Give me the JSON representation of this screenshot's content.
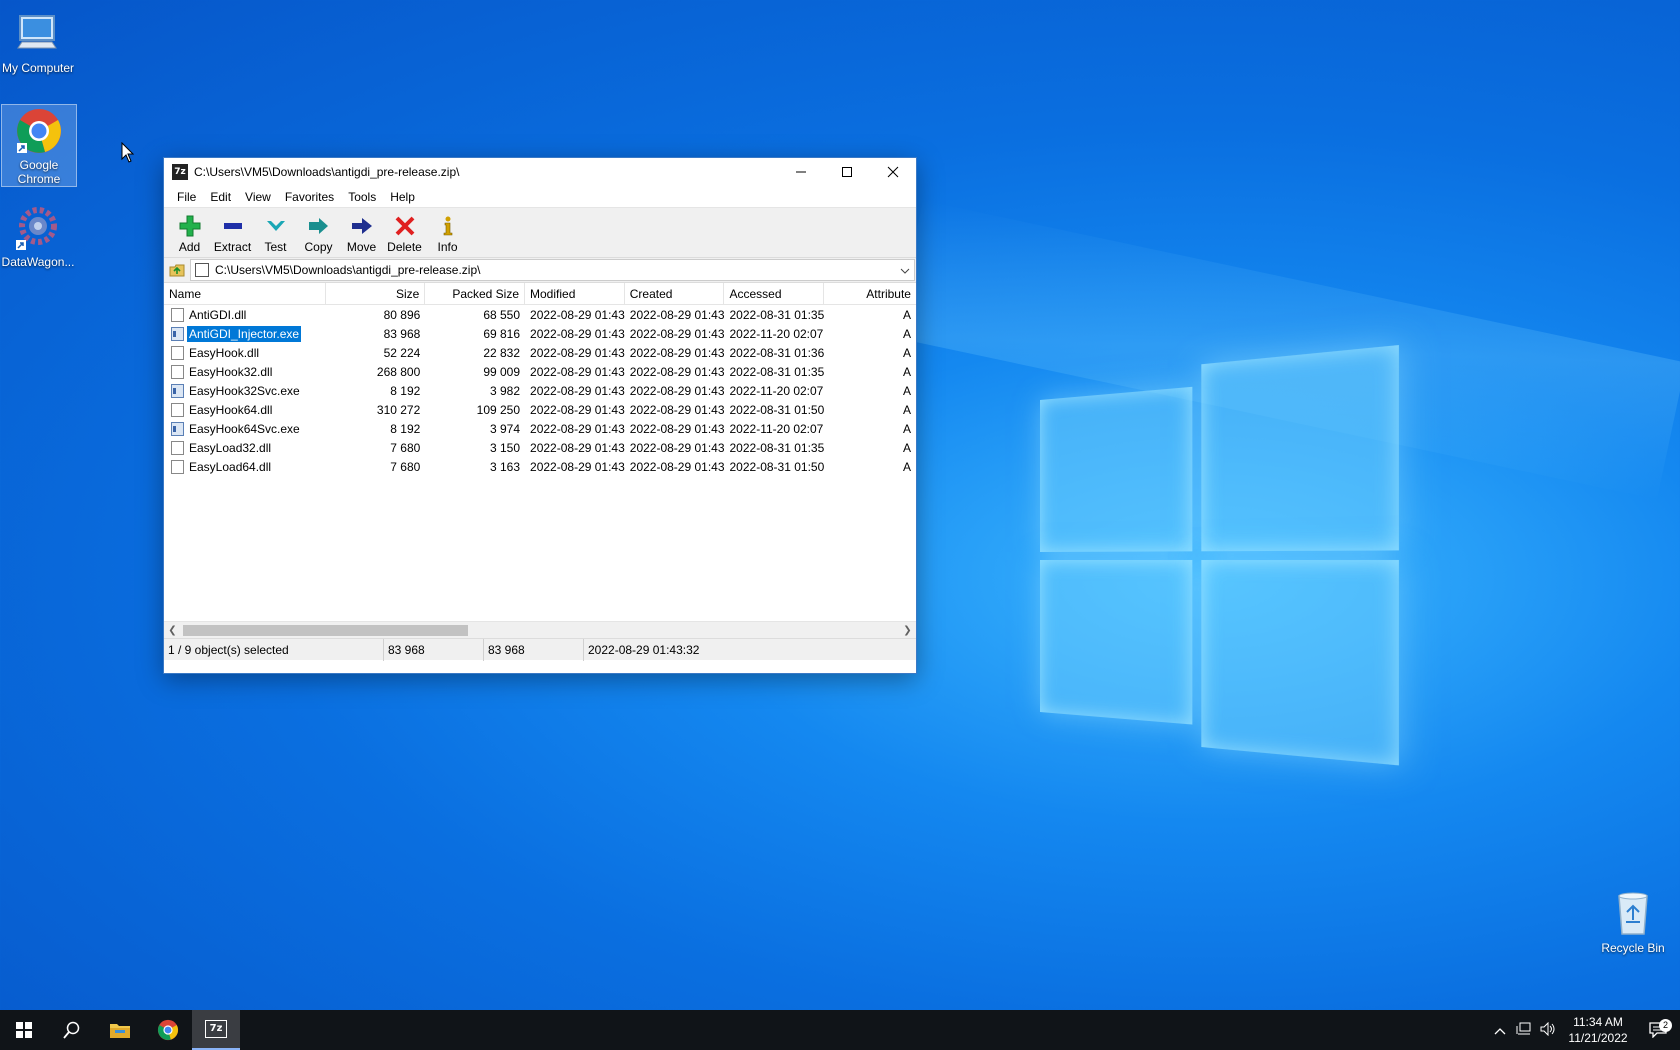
{
  "desktop": {
    "icons": [
      {
        "label": "My Computer"
      },
      {
        "label": "Google Chrome"
      },
      {
        "label": "DataWagon..."
      },
      {
        "label": "Recycle Bin"
      }
    ]
  },
  "window": {
    "title": "C:\\Users\\VM5\\Downloads\\antigdi_pre-release.zip\\",
    "app_icon_text": "7z",
    "menu": [
      "File",
      "Edit",
      "View",
      "Favorites",
      "Tools",
      "Help"
    ],
    "toolbar": [
      {
        "label": "Add",
        "icon": "plus-icon",
        "color": "#22b14c"
      },
      {
        "label": "Extract",
        "icon": "minus-icon",
        "color": "#1f2fa8"
      },
      {
        "label": "Test",
        "icon": "check-chevron-icon",
        "color": "#1aa7b5"
      },
      {
        "label": "Copy",
        "icon": "double-arrow-icon",
        "color": "#1a8f8f"
      },
      {
        "label": "Move",
        "icon": "arrow-right-icon",
        "color": "#1f2f8f"
      },
      {
        "label": "Delete",
        "icon": "x-icon",
        "color": "#e02020"
      },
      {
        "label": "Info",
        "icon": "info-icon",
        "color": "#d0a000"
      }
    ],
    "address": "C:\\Users\\VM5\\Downloads\\antigdi_pre-release.zip\\",
    "columns": [
      "Name",
      "Size",
      "Packed Size",
      "Modified",
      "Created",
      "Accessed",
      "Attribute"
    ],
    "files": [
      {
        "name": "AntiGDI.dll",
        "type": "dll",
        "size": "80 896",
        "packed": "68 550",
        "modified": "2022-08-29 01:43",
        "created": "2022-08-29 01:43",
        "accessed": "2022-08-31 01:35",
        "attr": "A"
      },
      {
        "name": "AntiGDI_Injector.exe",
        "type": "exe",
        "size": "83 968",
        "packed": "69 816",
        "modified": "2022-08-29 01:43",
        "created": "2022-08-29 01:43",
        "accessed": "2022-11-20 02:07",
        "attr": "A",
        "selected": true
      },
      {
        "name": "EasyHook.dll",
        "type": "dll",
        "size": "52 224",
        "packed": "22 832",
        "modified": "2022-08-29 01:43",
        "created": "2022-08-29 01:43",
        "accessed": "2022-08-31 01:36",
        "attr": "A"
      },
      {
        "name": "EasyHook32.dll",
        "type": "dll",
        "size": "268 800",
        "packed": "99 009",
        "modified": "2022-08-29 01:43",
        "created": "2022-08-29 01:43",
        "accessed": "2022-08-31 01:35",
        "attr": "A"
      },
      {
        "name": "EasyHook32Svc.exe",
        "type": "exe",
        "size": "8 192",
        "packed": "3 982",
        "modified": "2022-08-29 01:43",
        "created": "2022-08-29 01:43",
        "accessed": "2022-11-20 02:07",
        "attr": "A"
      },
      {
        "name": "EasyHook64.dll",
        "type": "dll",
        "size": "310 272",
        "packed": "109 250",
        "modified": "2022-08-29 01:43",
        "created": "2022-08-29 01:43",
        "accessed": "2022-08-31 01:50",
        "attr": "A"
      },
      {
        "name": "EasyHook64Svc.exe",
        "type": "exe",
        "size": "8 192",
        "packed": "3 974",
        "modified": "2022-08-29 01:43",
        "created": "2022-08-29 01:43",
        "accessed": "2022-11-20 02:07",
        "attr": "A"
      },
      {
        "name": "EasyLoad32.dll",
        "type": "dll",
        "size": "7 680",
        "packed": "3 150",
        "modified": "2022-08-29 01:43",
        "created": "2022-08-29 01:43",
        "accessed": "2022-08-31 01:35",
        "attr": "A"
      },
      {
        "name": "EasyLoad64.dll",
        "type": "dll",
        "size": "7 680",
        "packed": "3 163",
        "modified": "2022-08-29 01:43",
        "created": "2022-08-29 01:43",
        "accessed": "2022-08-31 01:50",
        "attr": "A"
      }
    ],
    "status": {
      "selection": "1 / 9 object(s) selected",
      "size": "83 968",
      "packed": "83 968",
      "modified": "2022-08-29 01:43:32"
    }
  },
  "taskbar": {
    "time": "11:34 AM",
    "date": "11/21/2022",
    "notification_count": "2",
    "active_app_text": "7z"
  }
}
